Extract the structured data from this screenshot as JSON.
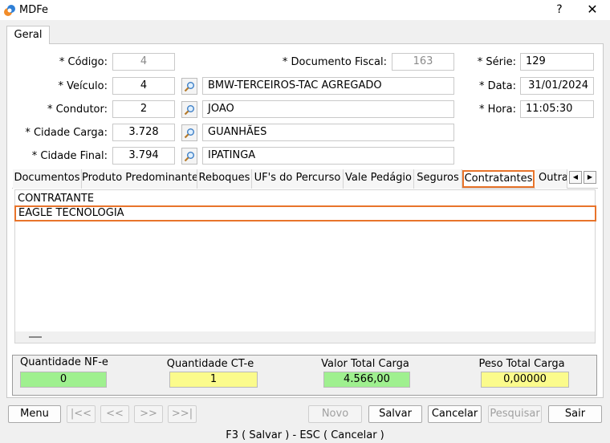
{
  "window": {
    "title": "MDFe",
    "help_label": "?",
    "close_label": "✕"
  },
  "main_tab": "Geral",
  "form": {
    "codigo": {
      "label": "* Código:",
      "value": "4"
    },
    "documento_fiscal": {
      "label": "* Documento Fiscal:",
      "value": "163"
    },
    "serie": {
      "label": "* Série:",
      "value": "129"
    },
    "veiculo": {
      "label": "* Veículo:",
      "value": "4",
      "description": "BMW-TERCEIROS-TAC AGREGADO"
    },
    "data": {
      "label": "* Data:",
      "value": "31/01/2024"
    },
    "condutor": {
      "label": "* Condutor:",
      "value": "2",
      "description": "JOAO"
    },
    "hora": {
      "label": "* Hora:",
      "value": "11:05:30"
    },
    "cidade_carga": {
      "label": "* Cidade Carga:",
      "value": "3.728",
      "description": "GUANHÃES"
    },
    "cidade_final": {
      "label": "* Cidade Final:",
      "value": "3.794",
      "description": "IPATINGA"
    }
  },
  "subtabs": [
    "Documentos",
    "Produto Predominante",
    "Reboques",
    "UF's do Percurso",
    "Vale Pedágio",
    "Seguros",
    "Contratantes",
    "Outra"
  ],
  "active_subtab": "Contratantes",
  "grid": {
    "header": "CONTRATANTE",
    "rows": [
      "EAGLE TECNOLOGIA"
    ]
  },
  "totals": {
    "nfe": {
      "label": "Quantidade NF-e",
      "value": "0"
    },
    "cte": {
      "label": "Quantidade CT-e",
      "value": "1"
    },
    "valor": {
      "label": "Valor Total Carga",
      "value": "4.566,00"
    },
    "peso": {
      "label": "Peso Total Carga",
      "value": "0,00000"
    }
  },
  "buttons": {
    "menu": "Menu",
    "first": "|<<",
    "prev": "<<",
    "next": ">>",
    "last": ">>|",
    "novo": "Novo",
    "salvar": "Salvar",
    "cancelar": "Cancelar",
    "pesquisar": "Pesquisar",
    "sair": "Sair"
  },
  "footer": "F3 ( Salvar )  -  ESC ( Cancelar )",
  "colors": {
    "accent": "#e8742b",
    "green": "#9ff08f",
    "yellow": "#fbfb8c"
  },
  "icons": {
    "lookup": "magnifier-icon",
    "app": "app-logo-icon"
  }
}
